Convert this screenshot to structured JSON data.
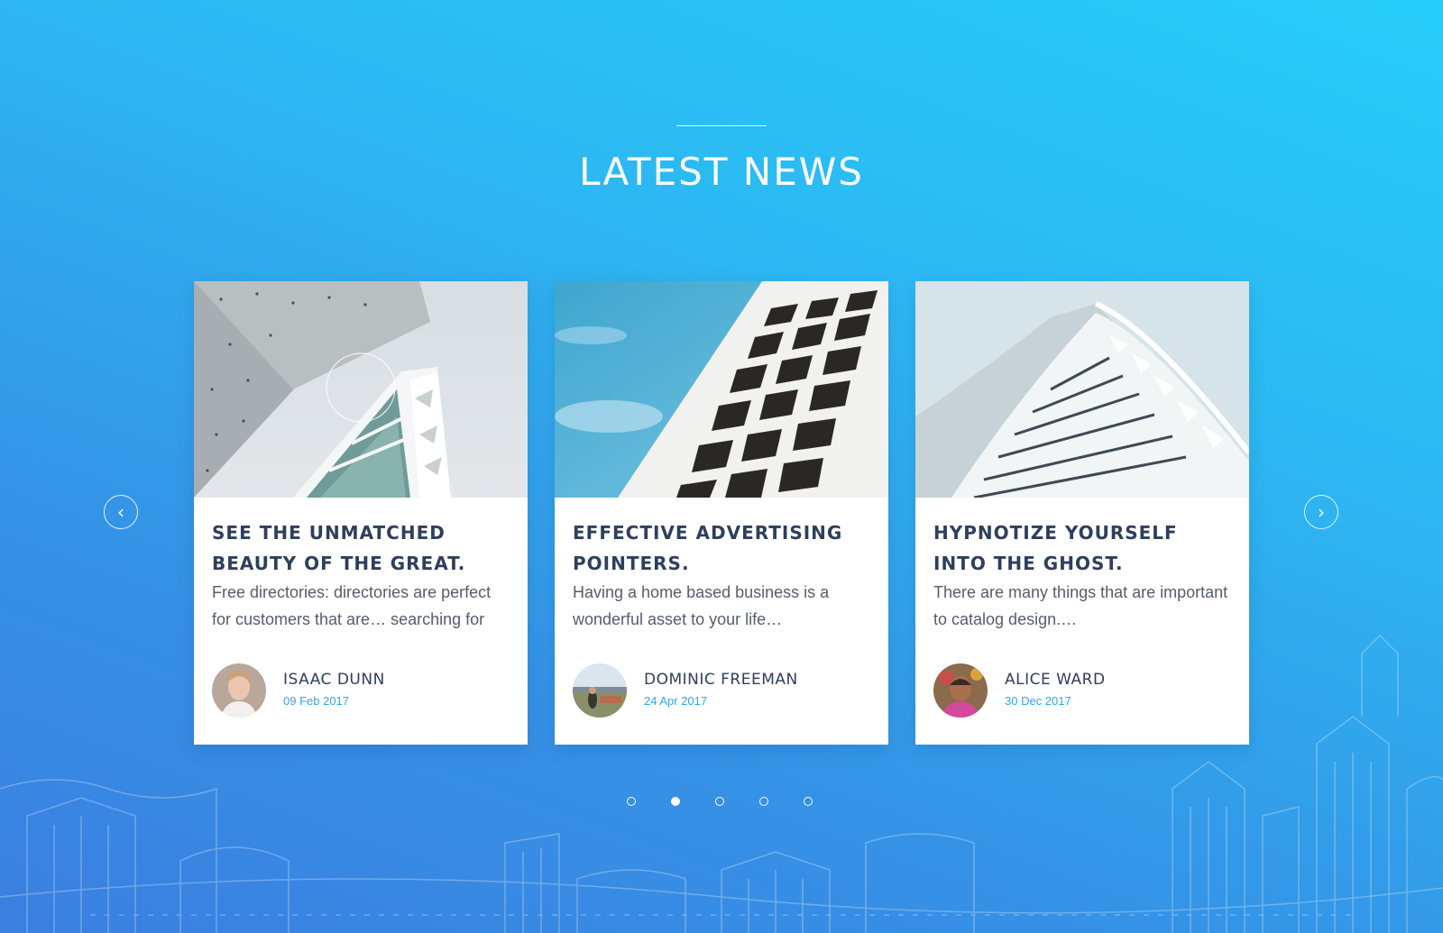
{
  "section": {
    "title": "LATEST NEWS"
  },
  "carousel": {
    "prev_icon": "chevron-left-icon",
    "next_icon": "chevron-right-icon",
    "prev_glyph": "‹",
    "next_glyph": "›",
    "active_dot": 2,
    "dot_count": 5
  },
  "cards": [
    {
      "title": "SEE THE UNMATCHED BEAUTY OF THE GREAT.",
      "excerpt": "Free directories: directories are perfect for customers that are… searching for",
      "author": "ISAAC DUNN",
      "date": "09 Feb 2017"
    },
    {
      "title": "EFFECTIVE ADVERTISING POINTERS.",
      "excerpt": "Having a home based business is a wonderful asset to your life…",
      "author": "DOMINIC FREEMAN",
      "date": "24 Apr 2017"
    },
    {
      "title": "HYPNOTIZE YOURSELF INTO THE GHOST.",
      "excerpt": "There are many things that are important to catalog design.…",
      "author": "ALICE WARD",
      "date": "30 Dec 2017"
    }
  ],
  "colors": {
    "gradient_top": "#26cdf9",
    "gradient_bottom": "#3b7fdf",
    "title_text": "#2e3f5c",
    "date_accent": "#2aa8ee",
    "card_background": "#ffffff"
  }
}
